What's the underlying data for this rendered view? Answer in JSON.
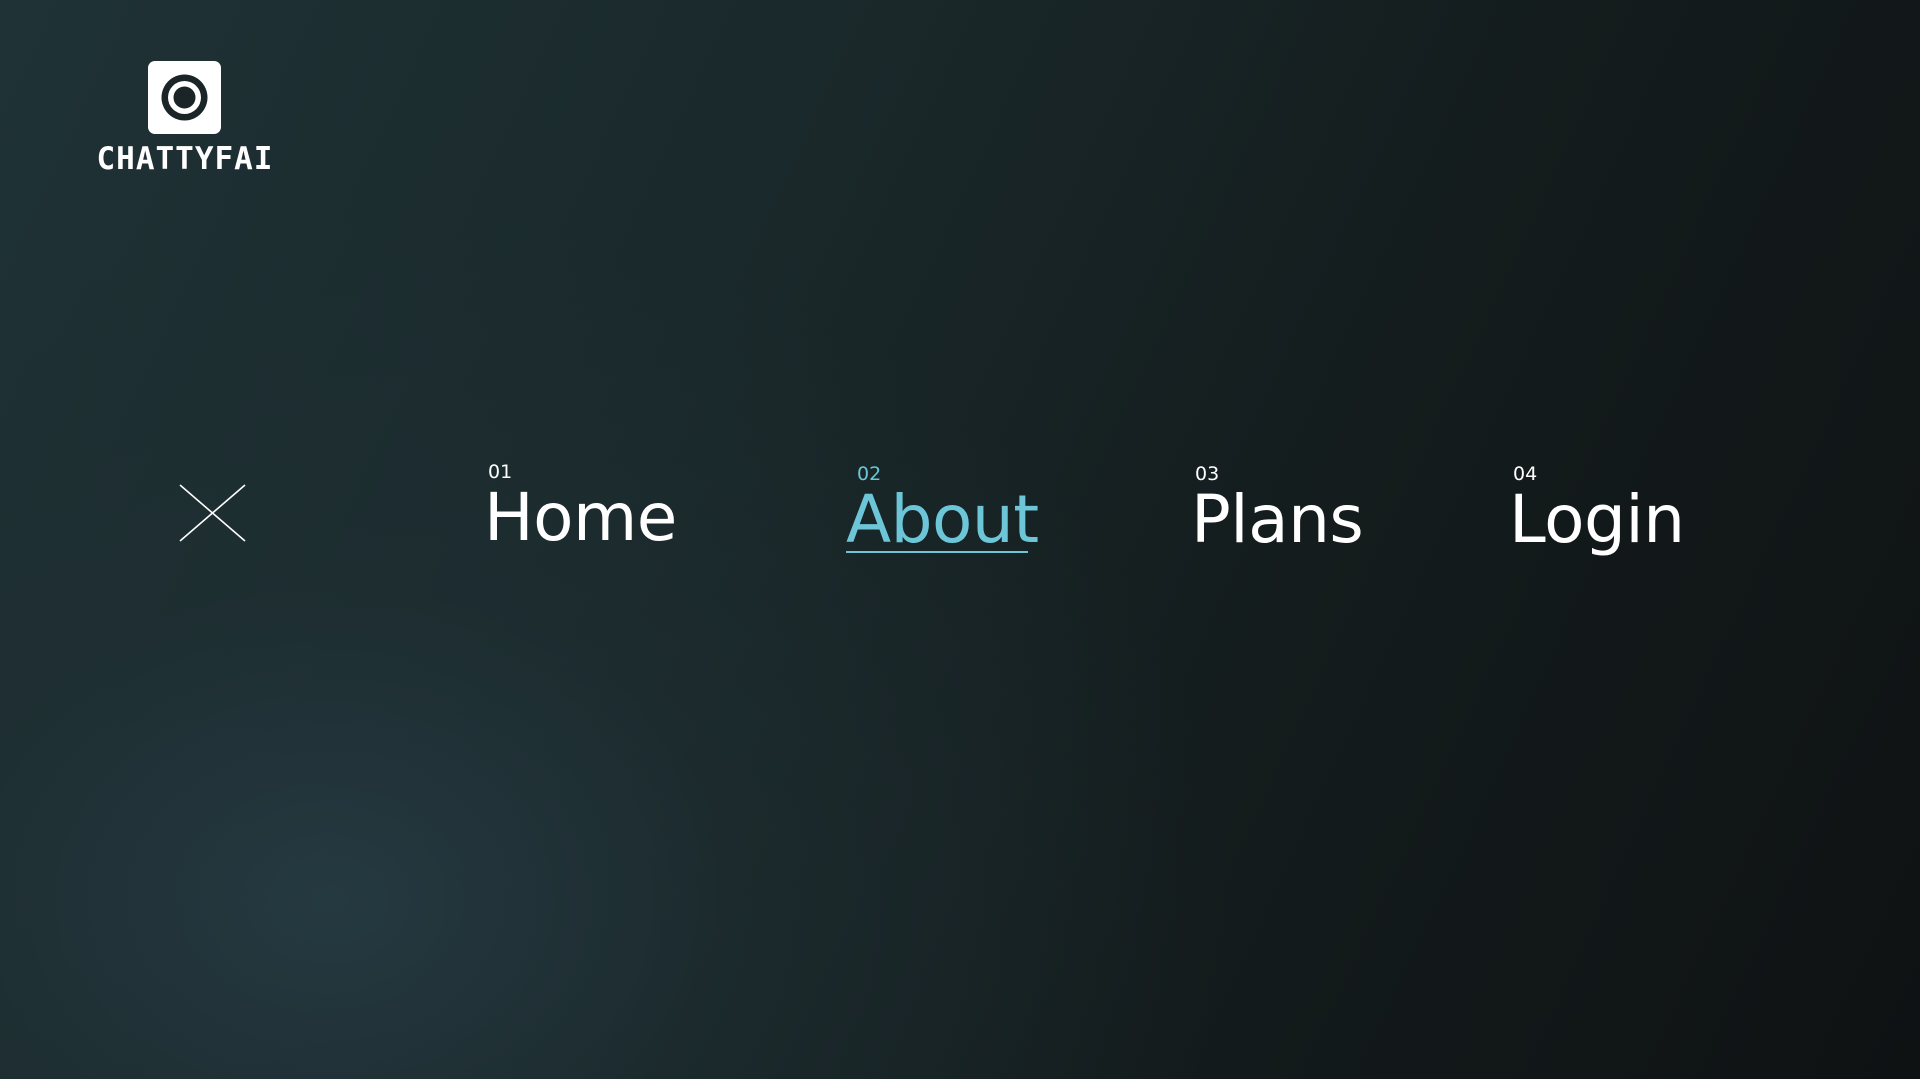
{
  "brand": {
    "name": "CHATTYFAI",
    "logo_icon": "target-icon"
  },
  "colors": {
    "accent": "#6cc6d8",
    "text": "#ffffff",
    "background_dark": "#0f1213",
    "background_teal": "#263a42"
  },
  "menu": {
    "close_icon": "close-icon",
    "active": "about",
    "items": [
      {
        "id": "home",
        "number": "01",
        "label": "Home"
      },
      {
        "id": "about",
        "number": "02",
        "label": "About"
      },
      {
        "id": "plans",
        "number": "03",
        "label": "Plans"
      },
      {
        "id": "login",
        "number": "04",
        "label": "Login"
      }
    ]
  }
}
